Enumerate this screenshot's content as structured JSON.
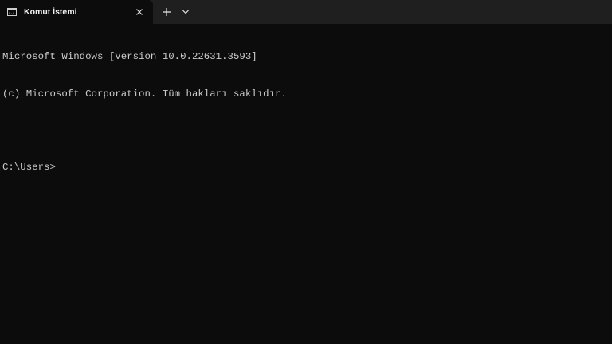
{
  "tab": {
    "title": "Komut İstemi",
    "icon": "command-prompt-icon",
    "active": true
  },
  "tabbar": {
    "new_tab_icon": "plus-icon",
    "dropdown_icon": "chevron-down-icon",
    "close_icon": "close-icon"
  },
  "terminal": {
    "lines": [
      "Microsoft Windows [Version 10.0.22631.3593]",
      "(c) Microsoft Corporation. Tüm hakları saklıdır."
    ],
    "prompt": "C:\\Users>",
    "input": ""
  },
  "colors": {
    "background": "#0c0c0c",
    "tabbar": "#1f1f1f",
    "text": "#cccccc",
    "tab_text": "#f2f2f2"
  }
}
